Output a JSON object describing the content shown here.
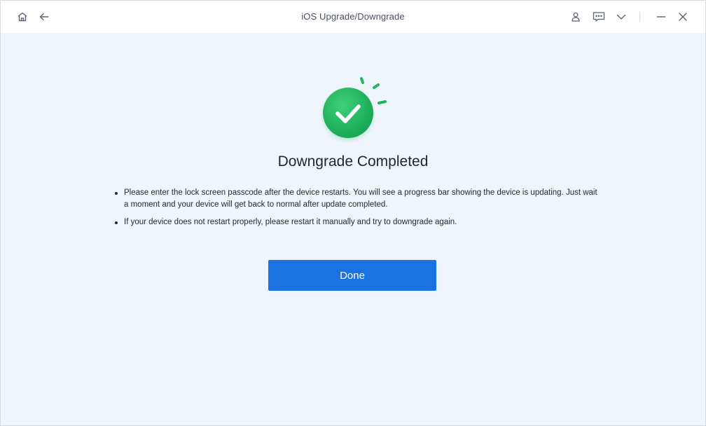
{
  "window": {
    "title": "iOS Upgrade/Downgrade",
    "left_icons": [
      "home-icon",
      "back-arrow-icon"
    ],
    "right_icons": [
      "user-icon",
      "feedback-icon",
      "chevron-down-icon",
      "minimize-icon",
      "close-icon"
    ]
  },
  "main": {
    "status_icon": "success-check-icon",
    "heading": "Downgrade Completed",
    "tips": [
      "Please enter the lock screen passcode after the device restarts. You will see a progress bar showing the device is updating. Just wait a moment and your device will get back to normal after update completed.",
      "If your device does not restart properly, please restart it manually and try to downgrade again."
    ],
    "done_label": "Done"
  },
  "colors": {
    "accent_blue": "#1a73e0",
    "success_green": "#22b45e",
    "background": "#f0f5fc"
  }
}
